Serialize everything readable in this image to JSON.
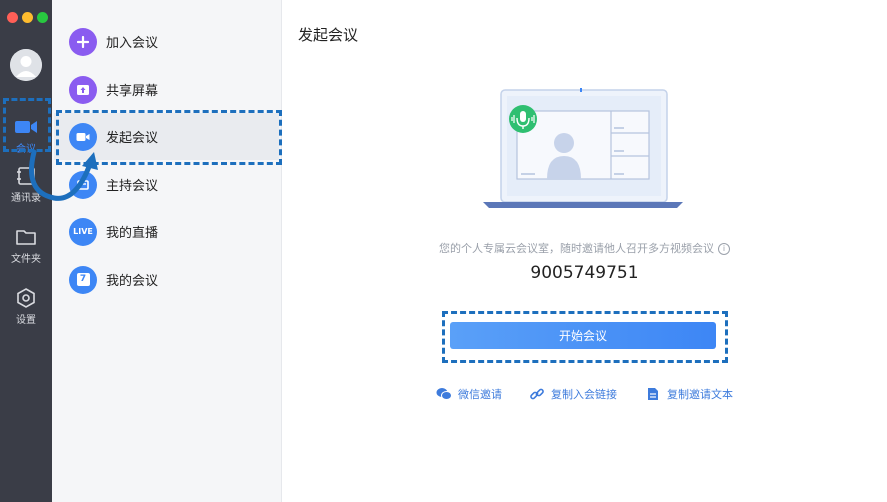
{
  "window": {
    "traffic_colors": [
      "#ff5f57",
      "#febc2e",
      "#28c840"
    ]
  },
  "rail": {
    "items": [
      {
        "label": "会议",
        "icon": "video-camera-icon",
        "active": true
      },
      {
        "label": "通讯录",
        "icon": "contacts-icon"
      },
      {
        "label": "文件夹",
        "icon": "folder-icon"
      },
      {
        "label": "设置",
        "icon": "settings-hexagon-icon"
      }
    ]
  },
  "menu": {
    "items": [
      {
        "label": "加入会议",
        "icon": "plus-icon",
        "color": "#8a5cf0"
      },
      {
        "label": "共享屏幕",
        "icon": "screen-share-icon",
        "color": "#8a5cf0"
      },
      {
        "label": "发起会议",
        "icon": "video-camera-icon",
        "color": "#3d86f5",
        "active": true
      },
      {
        "label": "主持会议",
        "icon": "host-icon",
        "color": "#3d86f5"
      },
      {
        "label": "我的直播",
        "icon": "live-icon",
        "icon_text": "LIVE",
        "color": "#3d86f5"
      },
      {
        "label": "我的会议",
        "icon": "calendar-icon",
        "icon_text": "7",
        "color": "#3d86f5"
      }
    ]
  },
  "main": {
    "title": "发起会议",
    "hint": "您的个人专属云会议室，随时邀请他人召开多方视频会议",
    "meeting_id": "9005749751",
    "start_button": "开始会议",
    "share_options": [
      {
        "label": "微信邀请",
        "icon": "wechat-icon"
      },
      {
        "label": "复制入会链接",
        "icon": "link-icon"
      },
      {
        "label": "复制邀请文本",
        "icon": "document-icon"
      }
    ]
  },
  "colors": {
    "accent": "#3d86f5",
    "annotation": "#1d6fbd",
    "rail_bg": "#3a3d47"
  }
}
